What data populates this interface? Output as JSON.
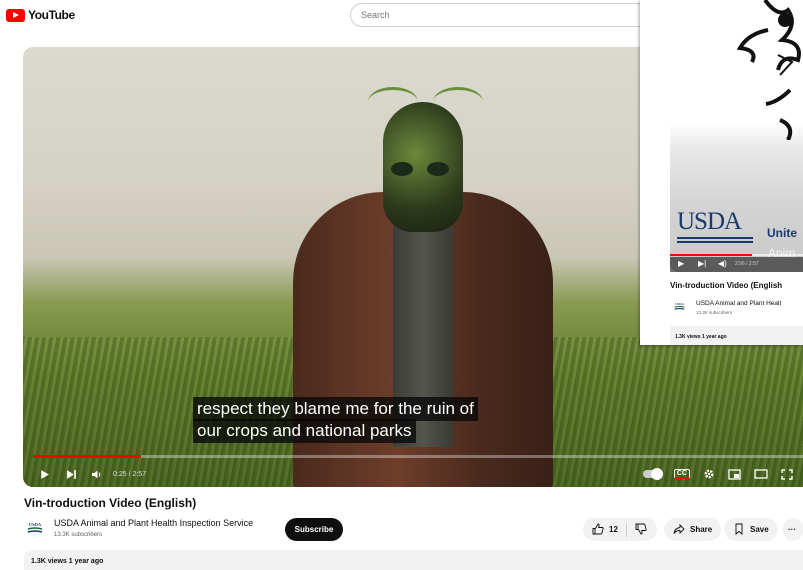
{
  "header": {
    "logo_text": "YouTube",
    "search_placeholder": "Search"
  },
  "player": {
    "caption_line1": "respect they blame me for the ruin of",
    "caption_line2": "our crops and national parks",
    "time": "0:25 / 2:57",
    "progress": 0.14,
    "cc_label": "CC"
  },
  "video": {
    "title": "Vin-troduction Video (English)",
    "channel": "USDA Animal and Plant Health Inspection Service",
    "subscribers": "13.3K subscribers",
    "subscribe_label": "Subscribe",
    "likes": "12",
    "share_label": "Share",
    "save_label": "Save",
    "more_label": "···",
    "meta": "1.3K views  1 year ago"
  },
  "overlay": {
    "usda": "USDA",
    "united": "Unite",
    "animal": "Anim",
    "time": "2:56 / 2:57",
    "title": "Vin-troduction Video (English",
    "channel": "USDA Animal and Plant Healt",
    "subscribers": "13.3K subscribers",
    "meta": "1.3K views  1 year ago"
  },
  "colors": {
    "brand_red": "#ff0000",
    "usda_blue": "#1a3a6a"
  }
}
